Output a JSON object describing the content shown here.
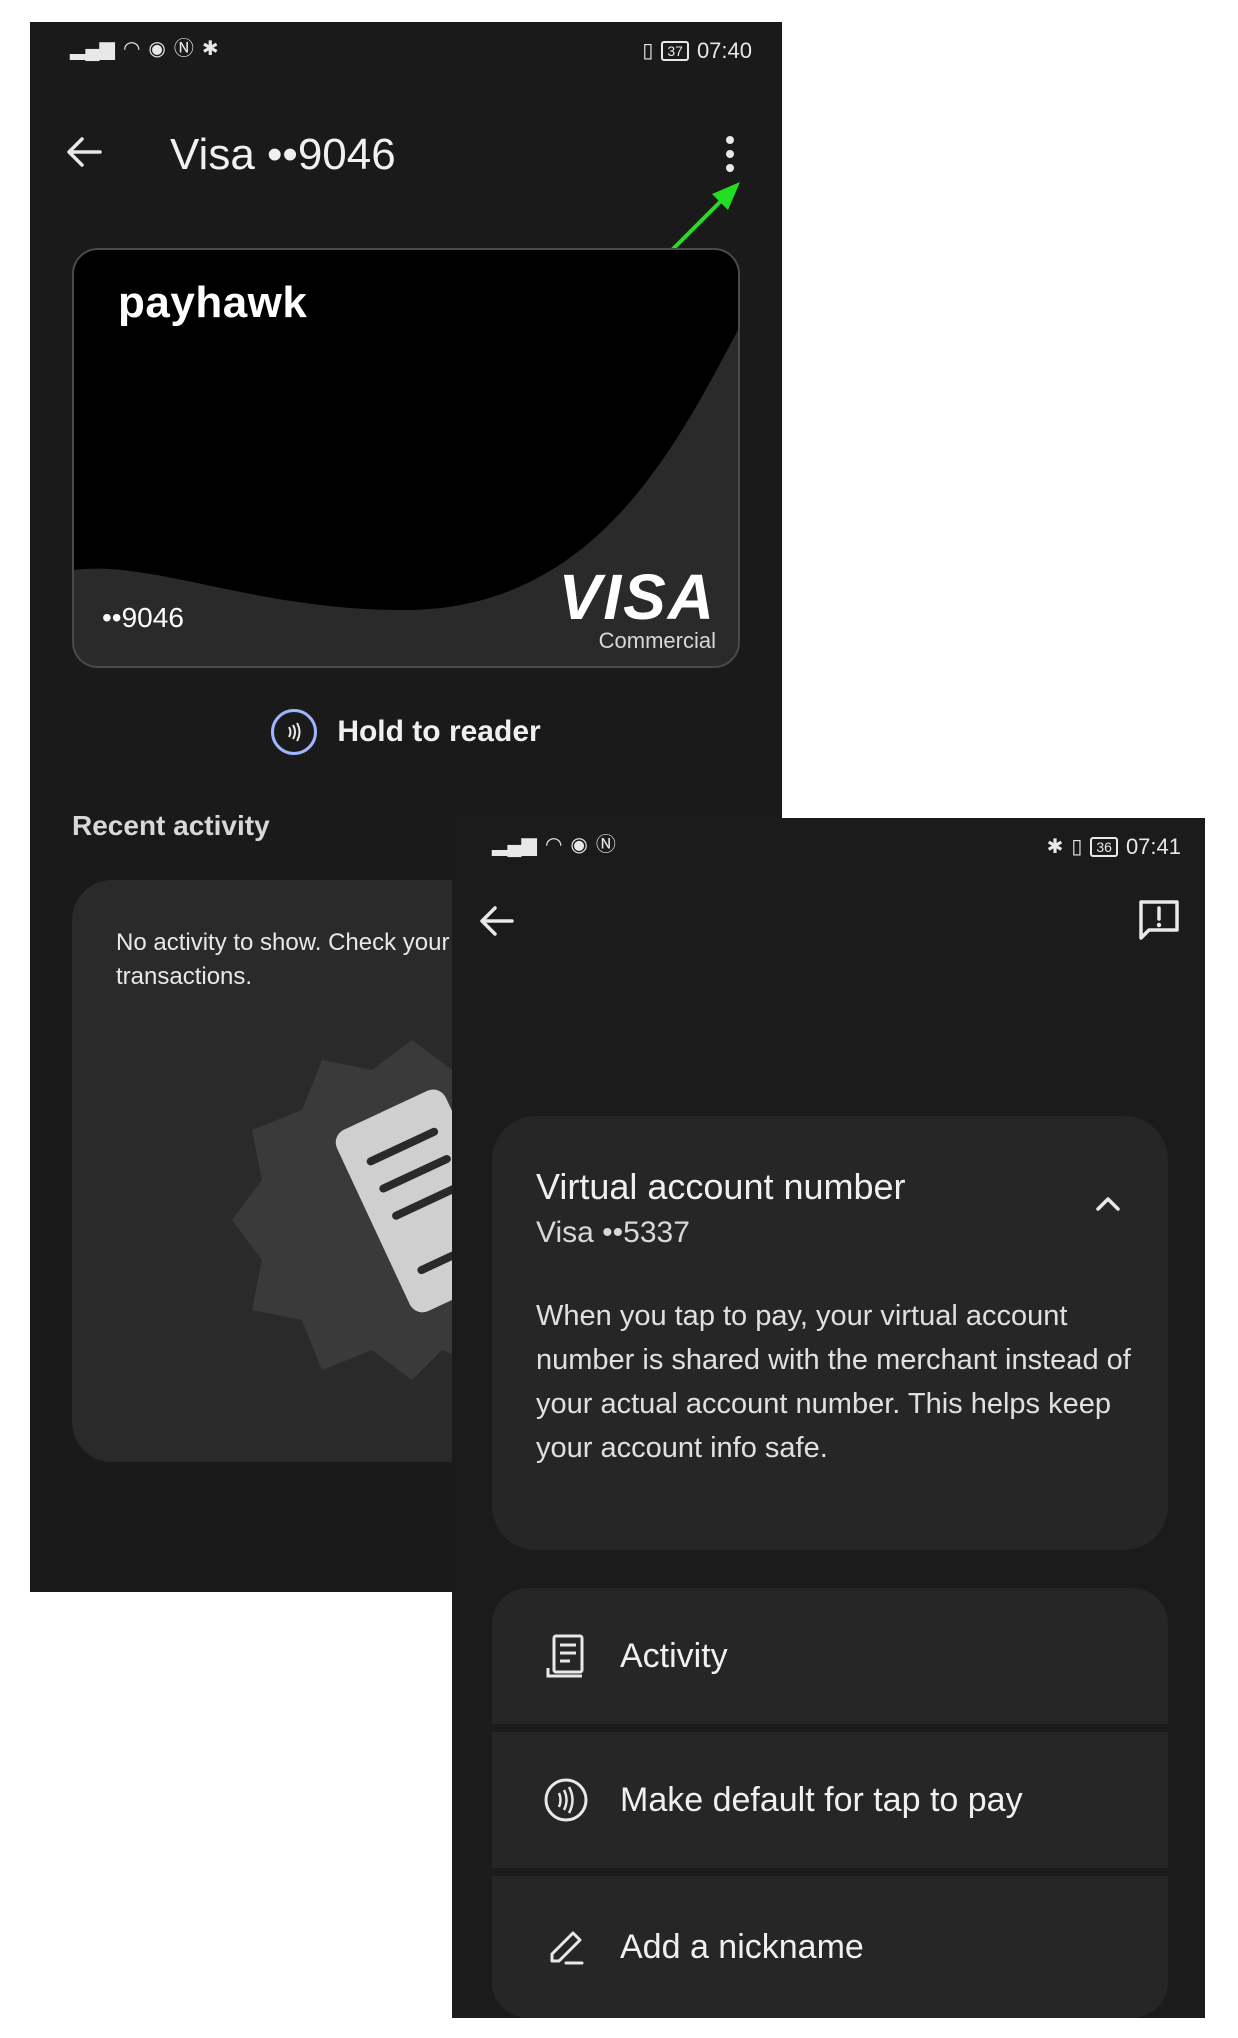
{
  "screen1": {
    "status": {
      "time": "07:40",
      "battery": "37"
    },
    "title": "Visa ••9046",
    "card": {
      "brand": "payhawk",
      "last4": "••9046",
      "network": "VISA",
      "network_sub": "Commercial"
    },
    "hold_label": "Hold to reader",
    "recent_title": "Recent activity",
    "no_activity": "No activity to show. Check your statement for final transactions."
  },
  "screen2": {
    "status": {
      "time": "07:41",
      "battery": "36"
    },
    "van": {
      "title": "Virtual account number",
      "subtitle": "Visa ••5337",
      "description": "When you tap to pay, your virtual account number is shared with the merchant instead of your actual account number. This helps keep your account info safe."
    },
    "options": {
      "activity": "Activity",
      "make_default": "Make default for tap to pay",
      "nickname": "Add a nickname"
    }
  },
  "colors": {
    "annotation_arrow": "#22dd22",
    "hold_ring": "#9fb6ff"
  },
  "icons": [
    "back-arrow-icon",
    "more-vert-icon",
    "contactless-icon",
    "receipt-icon",
    "feedback-icon",
    "chevron-up-icon",
    "edit-icon"
  ]
}
